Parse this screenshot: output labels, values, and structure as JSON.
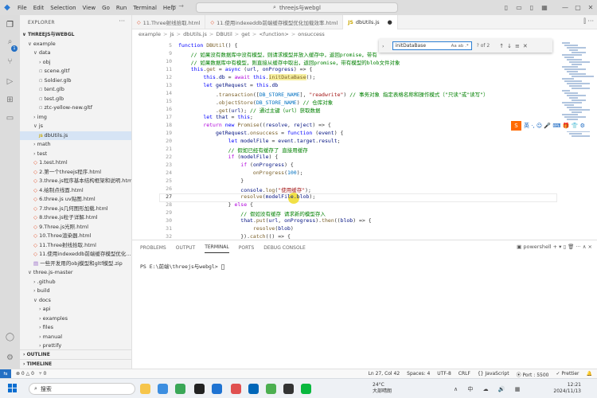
{
  "titlebar": {
    "menu": [
      "File",
      "Edit",
      "Selection",
      "View",
      "Go",
      "Run",
      "Terminal",
      "Help"
    ],
    "command_center": "threejs与webgl",
    "nav_back": "←",
    "nav_forward": "→"
  },
  "activity": {
    "extensions_badge": "1"
  },
  "sidebar": {
    "title": "EXPLORER",
    "more": "···",
    "root": "THREEJS与WEBGL",
    "items": [
      {
        "label": "example",
        "indent": 1,
        "type": "folder-open"
      },
      {
        "label": "data",
        "indent": 2,
        "type": "folder-open"
      },
      {
        "label": "obj",
        "indent": 3,
        "type": "folder"
      },
      {
        "label": "scene.gltf",
        "indent": 3,
        "type": "file"
      },
      {
        "label": "Soldier.glb",
        "indent": 3,
        "type": "file"
      },
      {
        "label": "tent.glb",
        "indent": 3,
        "type": "file"
      },
      {
        "label": "test.glb",
        "indent": 3,
        "type": "file"
      },
      {
        "label": "ztc-yellow-new.gltf",
        "indent": 3,
        "type": "file"
      },
      {
        "label": "img",
        "indent": 2,
        "type": "folder"
      },
      {
        "label": "js",
        "indent": 2,
        "type": "folder-open"
      },
      {
        "label": "dbUtils.js",
        "indent": 3,
        "type": "js",
        "selected": true
      },
      {
        "label": "math",
        "indent": 2,
        "type": "folder"
      },
      {
        "label": "test",
        "indent": 2,
        "type": "folder"
      },
      {
        "label": "1.test.html",
        "indent": 2,
        "type": "html"
      },
      {
        "label": "2.第一个threejs程序.html",
        "indent": 2,
        "type": "html"
      },
      {
        "label": "3.three.js程序基本结构框架和说明.html",
        "indent": 2,
        "type": "html"
      },
      {
        "label": "4.绘制点线面.html",
        "indent": 2,
        "type": "html"
      },
      {
        "label": "6.three.js uv贴图.html",
        "indent": 2,
        "type": "html"
      },
      {
        "label": "7.three.js几何图形加载.html",
        "indent": 2,
        "type": "html"
      },
      {
        "label": "8.three.js粒子详解.html",
        "indent": 2,
        "type": "html"
      },
      {
        "label": "9.Three.js光照.html",
        "indent": 2,
        "type": "html"
      },
      {
        "label": "10.Three渲染器.html",
        "indent": 2,
        "type": "html"
      },
      {
        "label": "11.Three射线拾取.html",
        "indent": 2,
        "type": "html"
      },
      {
        "label": "11.使用indexeddb前端缓存模型优化...",
        "indent": 2,
        "type": "html"
      },
      {
        "label": "一些开发用的obj模型和gltf模型.zip",
        "indent": 2,
        "type": "zip"
      },
      {
        "label": "three.js-master",
        "indent": 1,
        "type": "folder-open"
      },
      {
        "label": ".github",
        "indent": 2,
        "type": "folder"
      },
      {
        "label": "build",
        "indent": 2,
        "type": "folder"
      },
      {
        "label": "docs",
        "indent": 2,
        "type": "folder-open"
      },
      {
        "label": "api",
        "indent": 3,
        "type": "folder"
      },
      {
        "label": "examples",
        "indent": 3,
        "type": "folder"
      },
      {
        "label": "files",
        "indent": 3,
        "type": "folder"
      },
      {
        "label": "manual",
        "indent": 3,
        "type": "folder"
      },
      {
        "label": "prettify",
        "indent": 3,
        "type": "folder"
      }
    ],
    "outline": "OUTLINE",
    "timeline": "TIMELINE"
  },
  "tabs": [
    {
      "label": "11.Three射线拾取.html",
      "type": "html",
      "active": false
    },
    {
      "label": "11.使用indexeddb前端缓存模型优化加载效率.html",
      "type": "html",
      "active": false
    },
    {
      "label": "dbUtils.js",
      "type": "js",
      "active": true,
      "dirty": "●"
    }
  ],
  "breadcrumb": [
    "example",
    ">",
    "js",
    ">",
    "dbUtils.js",
    ">",
    "DBUtil",
    ">",
    "get",
    ">",
    "<function>",
    ">",
    "onsuccess"
  ],
  "find": {
    "value": "initDataBase",
    "count": "? of 2",
    "options": "Aa ab .*"
  },
  "editor": {
    "lines": [
      {
        "n": "5",
        "html": "<span class=\"k\">function</span> <span class=\"f\">DBUtil</span>() {"
      },
      {
        "n": "9",
        "html": "    <span class=\"c\">// 如果没有数据库中没有模型，则请求模型并放入缓存中，返回promise，带有</span>"
      },
      {
        "n": "10",
        "html": "    <span class=\"c\">// 如果数据库中有模型，则直接从缓存中取出，返回promise，带有模型的blob文件对象</span>"
      },
      {
        "n": "11",
        "html": "    <span class=\"k\">this</span>.<span class=\"f\">get</span> = <span class=\"k\">async</span> (<span class=\"v\">url</span>, <span class=\"v\">onProgress</span>) => {"
      },
      {
        "n": "12",
        "html": "        <span class=\"k\">this</span>.<span class=\"v\">db</span> = <span class=\"kc\">await</span> <span class=\"k\">this</span>.<span class=\"f hl\">initDataBase</span>();"
      },
      {
        "n": "13",
        "html": "        <span class=\"k\">let</span> <span class=\"v\">getRequest</span> = <span class=\"k\">this</span>.<span class=\"v\">db</span>"
      },
      {
        "n": "14",
        "html": "            .<span class=\"f\">transaction</span>([<span class=\"cst\">DB_STORE_NAME</span>], <span class=\"s\">\"readwrite\"</span>) <span class=\"c\">// 事务对象 指定表格名称和操作模式（\"只读\"或\"读写\"）</span>"
      },
      {
        "n": "15",
        "html": "            .<span class=\"f\">objectStore</span>(<span class=\"cst\">DB_STORE_NAME</span>) <span class=\"c\">// 仓库对象</span>"
      },
      {
        "n": "16",
        "html": "            .<span class=\"f\">get</span>(<span class=\"v\">url</span>); <span class=\"c\">// 通过主键（url）获取数据</span>"
      },
      {
        "n": "17",
        "html": "        <span class=\"k\">let</span> <span class=\"v\">that</span> = <span class=\"k\">this</span>;"
      },
      {
        "n": "18",
        "html": "        <span class=\"kc\">return</span> <span class=\"k\">new</span> <span class=\"f\">Promise</span>((<span class=\"v\">resolve</span>, <span class=\"v\">reject</span>) => {"
      },
      {
        "n": "19",
        "html": "            <span class=\"v\">getRequest</span>.<span class=\"f\">onsuccess</span> = <span class=\"k\">function</span> (<span class=\"v\">event</span>) {"
      },
      {
        "n": "20",
        "html": "                <span class=\"k\">let</span> <span class=\"v\">modelFile</span> = <span class=\"v\">event</span>.<span class=\"v\">target</span>.<span class=\"v\">result</span>;"
      },
      {
        "n": "21",
        "html": "                <span class=\"c\">// 假如已经有缓存了 直接用缓存</span>"
      },
      {
        "n": "22",
        "html": "                <span class=\"kc\">if</span> (<span class=\"v\">modelFile</span>) {"
      },
      {
        "n": "23",
        "html": "                    <span class=\"kc\">if</span> (<span class=\"v\">onProgress</span>) {"
      },
      {
        "n": "24",
        "html": "                        <span class=\"f\">onProgress</span>(<span class=\"cst\">100</span>);"
      },
      {
        "n": "25",
        "html": "                    }"
      },
      {
        "n": "26",
        "html": "                    <span class=\"v\">console</span>.<span class=\"f\">log</span>(<span class=\"s\">\"使用缓存\"</span>);"
      },
      {
        "n": "27",
        "html": "                    <span class=\"f\">resolve</span>(<span class=\"v\">modelFile</span>.<span class=\"v\">blob</span>);",
        "current": true
      },
      {
        "n": "28",
        "html": "                } <span class=\"kc\">else</span> {"
      },
      {
        "n": "29",
        "html": "                    <span class=\"c\">// 假如没有缓存 请求新的模型存入</span>"
      },
      {
        "n": "30",
        "html": "                    <span class=\"v\">that</span>.<span class=\"f\">put</span>(<span class=\"v\">url</span>, <span class=\"v\">onProgress</span>).<span class=\"f\">then</span>((<span class=\"v\">blob</span>) => {"
      },
      {
        "n": "31",
        "html": "                        <span class=\"f\">resolve</span>(<span class=\"v\">blob</span>)"
      },
      {
        "n": "32",
        "html": "                    }).<span class=\"f\">catch</span>(() => {"
      }
    ]
  },
  "ime": {
    "logo": "S",
    "text": "英 ·, ☺ 🎤 ⌨ 🎁 👕 ⚙"
  },
  "panel": {
    "tabs": [
      "PROBLEMS",
      "OUTPUT",
      "DEBUG CONSOLE",
      "TERMINAL",
      "PORTS",
      "DEBUG CONSOLE"
    ],
    "active_tab": "TERMINAL",
    "shell": "powershell",
    "actions": "+ ▾ ▯ 🗑 ··· ∧ ×",
    "prompt": "PS E:\\前端\\threejs与webgl> "
  },
  "status": {
    "left": [
      "⊗ 0 △ 0",
      "⑂ 0"
    ],
    "right": [
      "Ln 27, Col 42",
      "Spaces: 4",
      "UTF-8",
      "CRLF",
      "{} JavaScript",
      "⦿ Port : 5500",
      "✓ Prettier",
      "🔔"
    ]
  },
  "taskbar": {
    "search": "搜索",
    "weather_temp": "24°C",
    "weather_desc": "大部晴朗",
    "time": "12:21",
    "date": "2024/11/13",
    "sys": "∧ 中 ☁ 🔊 ▦"
  }
}
